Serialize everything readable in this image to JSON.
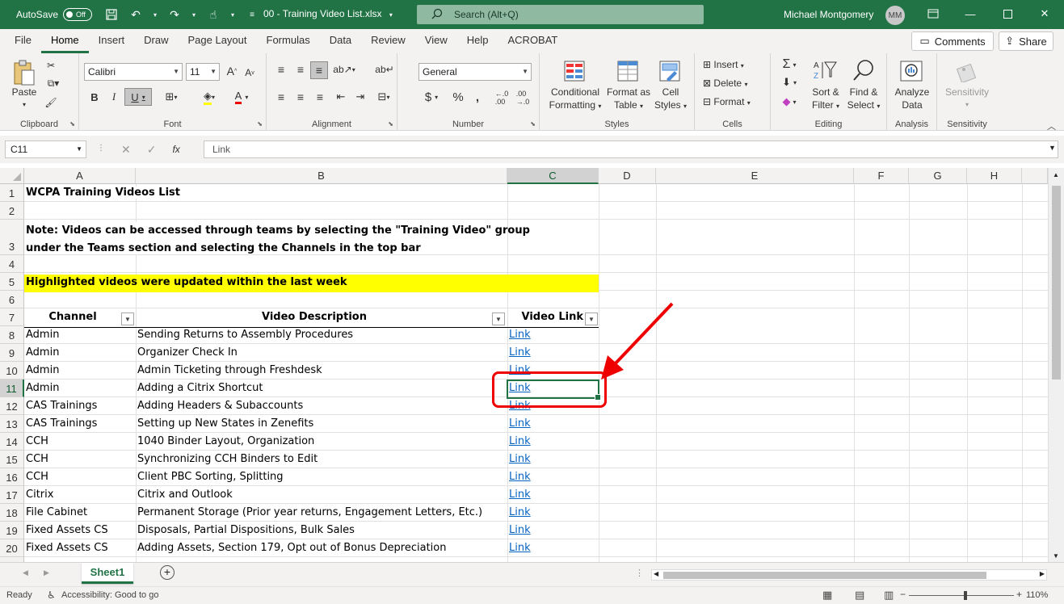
{
  "titlebar": {
    "autosave_label": "AutoSave",
    "autosave_state": "Off",
    "doc_title": "00 - Training Video List.xlsx",
    "search_placeholder": "Search (Alt+Q)",
    "user_name": "Michael Montgomery",
    "user_initials": "MM"
  },
  "ribbon_tabs": [
    "File",
    "Home",
    "Insert",
    "Draw",
    "Page Layout",
    "Formulas",
    "Data",
    "Review",
    "View",
    "Help",
    "ACROBAT"
  ],
  "active_tab": "Home",
  "buttons": {
    "comments": "Comments",
    "share": "Share"
  },
  "ribbon": {
    "clipboard": {
      "label": "Clipboard",
      "paste": "Paste"
    },
    "font": {
      "label": "Font",
      "name": "Calibri",
      "size": "11"
    },
    "alignment": {
      "label": "Alignment"
    },
    "number": {
      "label": "Number",
      "format": "General"
    },
    "styles": {
      "label": "Styles",
      "conditional_1": "Conditional",
      "conditional_2": "Formatting",
      "format_table_1": "Format as",
      "format_table_2": "Table",
      "cell_styles_1": "Cell",
      "cell_styles_2": "Styles"
    },
    "cells": {
      "label": "Cells",
      "insert": "Insert",
      "delete": "Delete",
      "format": "Format"
    },
    "editing": {
      "label": "Editing",
      "sort_1": "Sort &",
      "sort_2": "Filter",
      "find_1": "Find &",
      "find_2": "Select"
    },
    "analysis": {
      "label": "Analysis",
      "analyze_1": "Analyze",
      "analyze_2": "Data"
    },
    "sensitivity": {
      "label": "Sensitivity",
      "button": "Sensitivity"
    }
  },
  "formula_bar": {
    "name_box": "C11",
    "fx": "fx",
    "content": "Link"
  },
  "columns": [
    "A",
    "B",
    "C",
    "D",
    "E",
    "F",
    "G",
    "H"
  ],
  "selected_column": "C",
  "selected_row": "11",
  "rows": [
    "1",
    "2",
    "3",
    "4",
    "5",
    "6",
    "7",
    "8",
    "9",
    "10",
    "11",
    "12",
    "13",
    "14",
    "15",
    "16",
    "17",
    "18",
    "19",
    "20"
  ],
  "sheet": {
    "title": "WCPA Training Videos List",
    "note_line1": "Note: Videos can be accessed through teams by selecting the \"Training Video\" group",
    "note_line2": "under the Teams section and selecting the Channels in the top bar",
    "highlight_note": "Highlighted videos were updated within the last week",
    "headers": {
      "channel": "Channel",
      "description": "Video Description",
      "link": "Video Link"
    },
    "entries": [
      {
        "channel": "Admin",
        "description": "Sending Returns to Assembly Procedures",
        "link": "Link"
      },
      {
        "channel": "Admin",
        "description": "Organizer Check In",
        "link": "Link"
      },
      {
        "channel": "Admin",
        "description": "Admin Ticketing through Freshdesk",
        "link": "Link"
      },
      {
        "channel": "Admin",
        "description": "Adding a Citrix Shortcut",
        "link": "Link"
      },
      {
        "channel": "CAS Trainings",
        "description": "Adding Headers & Subaccounts",
        "link": "Link"
      },
      {
        "channel": "CAS Trainings",
        "description": "Setting up New States in Zenefits",
        "link": "Link"
      },
      {
        "channel": "CCH",
        "description": "1040 Binder Layout, Organization",
        "link": "Link"
      },
      {
        "channel": "CCH",
        "description": "Synchronizing CCH Binders to Edit",
        "link": "Link"
      },
      {
        "channel": "CCH",
        "description": "Client PBC Sorting, Splitting",
        "link": "Link"
      },
      {
        "channel": "Citrix",
        "description": "Citrix and Outlook",
        "link": "Link"
      },
      {
        "channel": "File Cabinet",
        "description": "Permanent Storage (Prior year returns, Engagement Letters, Etc.)",
        "link": "Link"
      },
      {
        "channel": "Fixed Assets CS",
        "description": "Disposals, Partial Dispositions, Bulk Sales",
        "link": "Link"
      },
      {
        "channel": "Fixed Assets CS",
        "description": "Adding Assets, Section 179, Opt out of Bonus Depreciation",
        "link": "Link"
      }
    ]
  },
  "sheet_tab": "Sheet1",
  "status": {
    "ready": "Ready",
    "accessibility": "Accessibility: Good to go",
    "zoom": "110%"
  },
  "colors": {
    "excel_green": "#217346",
    "highlight": "#ffff00",
    "link": "#0563c1",
    "annotation_red": "#e00000"
  }
}
